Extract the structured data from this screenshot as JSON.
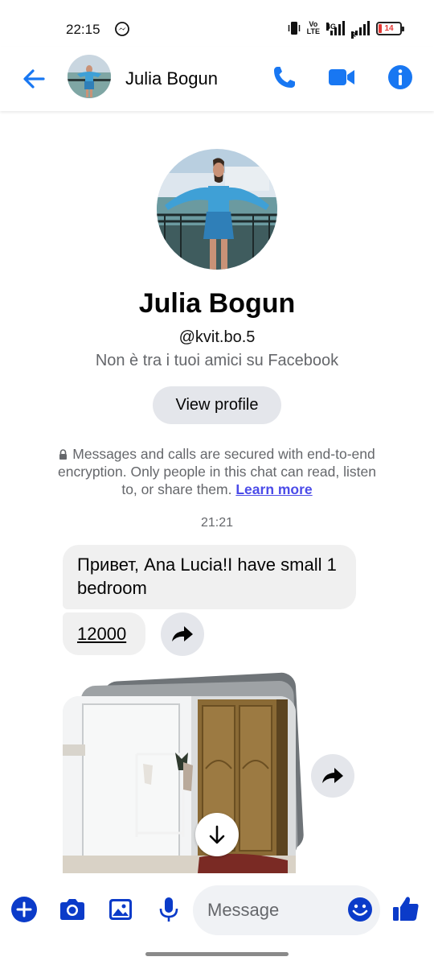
{
  "status_bar": {
    "time": "22:15",
    "volte_top": "Vo",
    "volte_bottom": "LTE",
    "network": "4G",
    "roaming": "R",
    "battery": "14",
    "icons": [
      "messenger-icon",
      "vibrate-icon",
      "signal-icon",
      "battery-icon"
    ]
  },
  "header": {
    "name": "Julia Bogun",
    "icons": [
      "back-arrow-icon",
      "phone-icon",
      "video-camera-icon",
      "info-icon"
    ],
    "accent_color": "#1877f2"
  },
  "profile": {
    "name": "Julia Bogun",
    "handle": "@kvit.bo.5",
    "friend_status": "Non è tra i tuoi amici su Facebook",
    "view_profile_label": "View profile"
  },
  "encryption": {
    "text": "Messages and calls are secured with end-to-end encryption. Only people in this chat can read, listen to, or share them.",
    "learn_more": "Learn more"
  },
  "conversation": {
    "timestamp": "21:21",
    "messages": [
      {
        "text": "Привет, Ana Lucia!I have small 1 bedroom"
      },
      {
        "text": "12000"
      }
    ]
  },
  "composer": {
    "placeholder": "Message",
    "icons": [
      "plus-icon",
      "camera-icon",
      "gallery-icon",
      "microphone-icon",
      "emoji-icon",
      "thumbs-up-icon"
    ]
  },
  "colors": {
    "accent": "#1877f2",
    "bubble": "#f0f0f0",
    "secondary_text": "#65676b",
    "link": "#4b4be8"
  }
}
